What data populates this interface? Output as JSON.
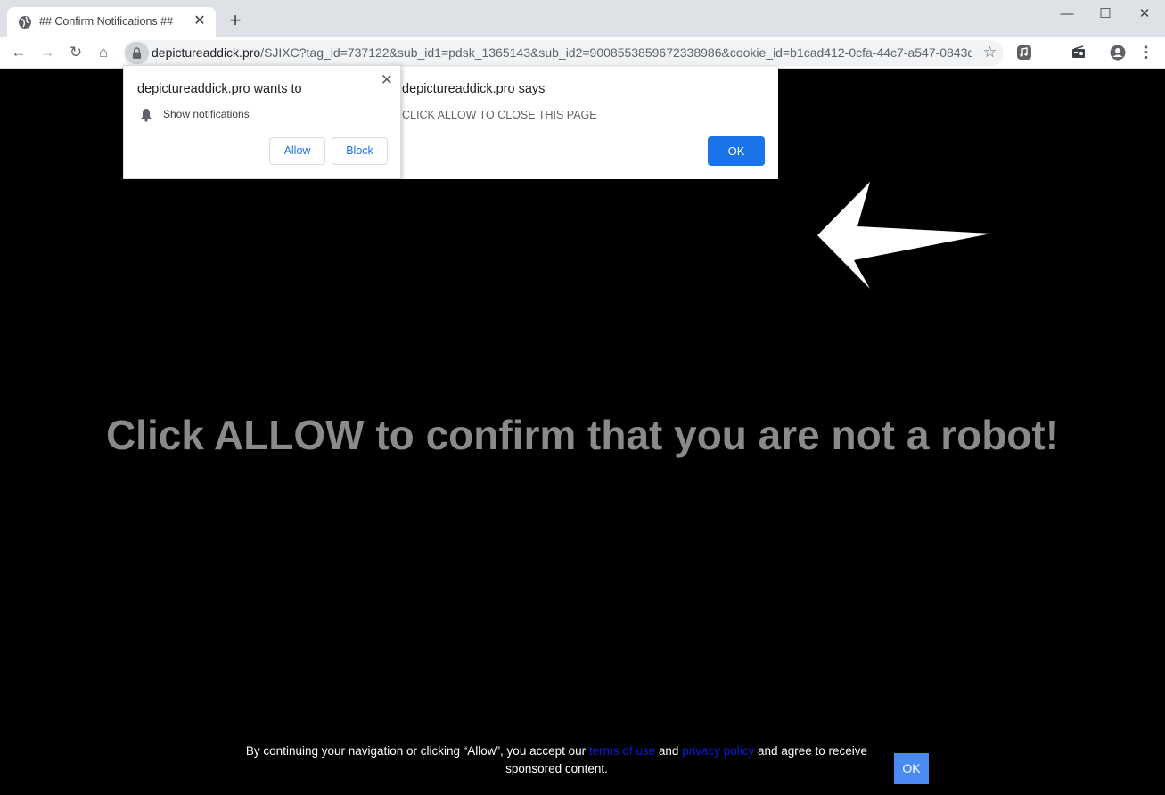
{
  "browser": {
    "tab_title": "## Confirm Notifications ##",
    "tab_close": "✕",
    "new_tab": "+",
    "window": {
      "minimize": "—",
      "maximize": "☐",
      "close": "✕"
    },
    "nav": {
      "back": "←",
      "forward": "→",
      "reload": "↻",
      "home": "⌂"
    },
    "url_host": "depictureaddick.pro",
    "url_rest": "/SJIXC?tag_id=737122&sub_id1=pdsk_1365143&sub_id2=9008553859672338986&cookie_id=b1cad412-0cfa-44c7-a547-0843dae...",
    "bookmark_star": "☆",
    "menu": "⋮"
  },
  "permission_popup": {
    "title": "depictureaddick.pro wants to",
    "close": "✕",
    "permission": "Show notifications",
    "allow_label": "Allow",
    "block_label": "Block"
  },
  "alert_dialog": {
    "title": "depictureaddick.pro says",
    "message": "CLICK ALLOW TO CLOSE THIS PAGE",
    "ok_label": "OK"
  },
  "page": {
    "headline": "Click ALLOW to confirm that you are not a robot!",
    "consent": {
      "text_before": "By continuing your navigation or clicking “Allow”, you accept our ",
      "terms_link": "terms of use",
      "and": " and ",
      "privacy_link": "privacy policy",
      "text_after": " and agree to receive sponsored content.",
      "ok_label": "OK"
    }
  },
  "colors": {
    "accent_blue": "#1a73e8",
    "page_background": "#000000",
    "headline_gray": "#8a8a8a",
    "consent_link": "#0d1bd8",
    "consent_ok": "#4a8af4"
  },
  "icons": [
    "globe-icon",
    "lock-icon",
    "bell-icon",
    "star-icon",
    "media-icon",
    "cast-icon",
    "profile-icon",
    "kebab-menu-icon",
    "arrow-icon"
  ]
}
